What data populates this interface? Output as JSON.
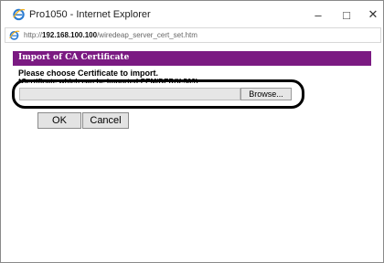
{
  "window": {
    "title": "Pro1050 - Internet Explorer",
    "controls": {
      "minimize": "–",
      "maximize": "□",
      "close": "✕"
    }
  },
  "address_bar": {
    "prefix": "http://",
    "host": "192.168.100.100",
    "path": "/wiredeap_server_cert_set.htm"
  },
  "dialog": {
    "section_title": "Import of CA Certificate",
    "prompt": "Please choose Certificate to import.",
    "partially_hidden_text": "*Certificate which can be imported:PEM/DER(X.509)",
    "file_input_value": "",
    "browse_label": "Browse...",
    "ok_label": "OK",
    "cancel_label": "Cancel"
  },
  "colors": {
    "section_bar": "#7b1a82",
    "highlight_oval": "#000000"
  },
  "icons": {
    "app": "internet-explorer-icon",
    "address": "internet-explorer-icon"
  }
}
